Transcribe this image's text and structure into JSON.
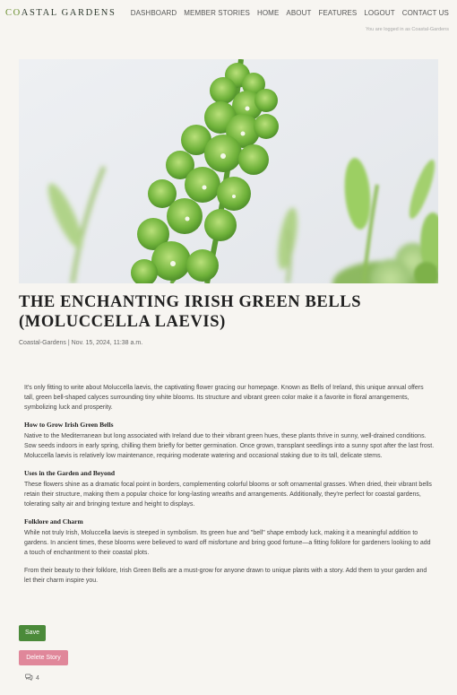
{
  "brand": {
    "accent": "Co",
    "rest": "astal Gardens"
  },
  "nav": {
    "items": [
      "Dashboard",
      "Member Stories",
      "Home",
      "About",
      "Features",
      "Logout",
      "Contact Us"
    ]
  },
  "status": {
    "logged_in": "You are logged in as Coastal-Gardens"
  },
  "hero": {
    "alt_subject": "Irish Green Bells flower"
  },
  "article": {
    "title": "The Enchanting Irish Green Bells (Moluccella laevis)",
    "meta": "Coastal-Gardens | Nov. 15, 2024, 11:38 a.m.",
    "intro": "It's only fitting to write about Moluccella laevis, the captivating flower gracing our homepage. Known as Bells of Ireland, this unique annual offers tall, green bell-shaped calyces surrounding tiny white blooms. Its structure and vibrant green color make it a favorite in floral arrangements, symbolizing luck and prosperity.",
    "sections": [
      {
        "heading": "How to Grow Irish Green Bells",
        "text": "Native to the Mediterranean but long associated with Ireland due to their vibrant green hues, these plants thrive in sunny, well-drained conditions. Sow seeds indoors in early spring, chilling them briefly for better germination. Once grown, transplant seedlings into a sunny spot after the last frost. Moluccella laevis is relatively low maintenance, requiring moderate watering and occasional staking due to its tall, delicate stems."
      },
      {
        "heading": "Uses in the Garden and Beyond",
        "text": "These flowers shine as a dramatic focal point in borders, complementing colorful blooms or soft ornamental grasses. When dried, their vibrant bells retain their structure, making them a popular choice for long-lasting wreaths and arrangements. Additionally, they're perfect for coastal gardens, tolerating salty air and bringing texture and height to displays."
      },
      {
        "heading": "Folklore and Charm",
        "text": "While not truly Irish, Moluccella laevis is steeped in symbolism. Its green hue and \"bell\" shape embody luck, making it a meaningful addition to gardens. In ancient times, these blooms were believed to ward off misfortune and bring good fortune—a fitting folklore for gardeners looking to add a touch of enchantment to their coastal plots."
      }
    ],
    "outro": "From their beauty to their folklore, Irish Green Bells are a must-grow for anyone drawn to unique plants with a story. Add them to your garden and let their charm inspire you."
  },
  "actions": {
    "save_label": "Save",
    "delete_label": "Delete Story"
  },
  "comments": {
    "icon": "comment-icon",
    "count": "4"
  },
  "colors": {
    "save": "#4b8a3a",
    "delete": "#e0879a",
    "background": "#f7f5f1",
    "brand_accent": "#6a8f2f"
  }
}
